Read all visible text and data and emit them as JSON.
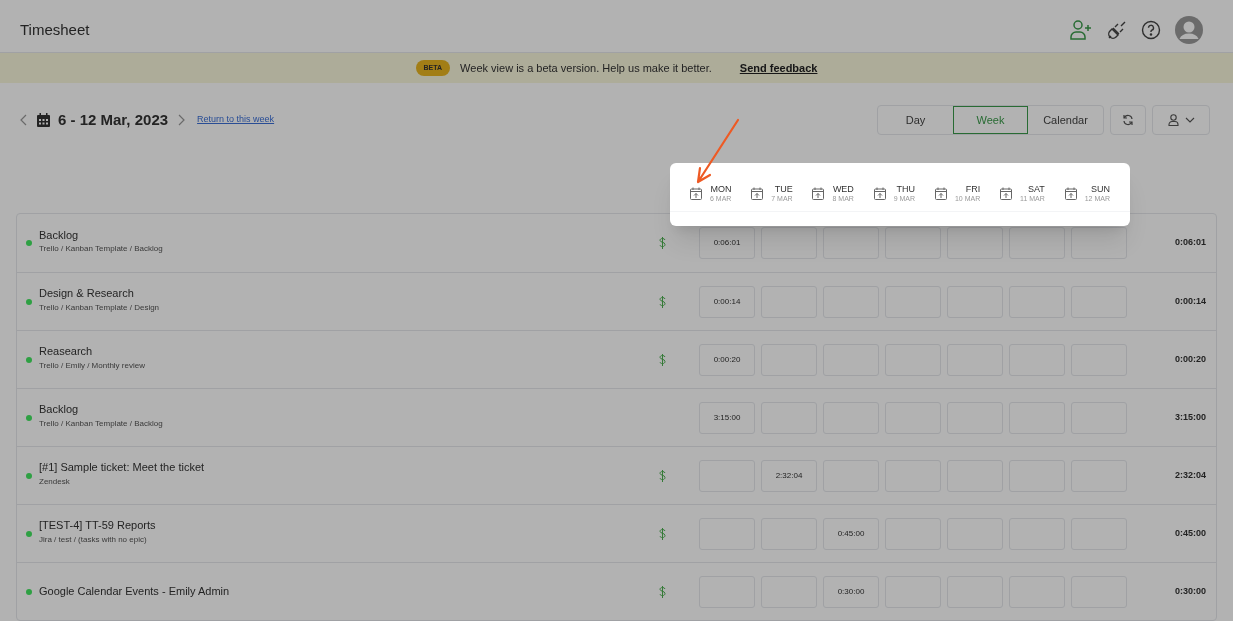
{
  "header": {
    "title": "Timesheet"
  },
  "banner": {
    "badge": "BETA",
    "message": "Week view is a beta version. Help us make it better.",
    "link": "Send feedback"
  },
  "toolbar": {
    "range": "6 - 12 Mar, 2023",
    "return_link": "Return to this week",
    "views": [
      {
        "label": "Day",
        "selected": false
      },
      {
        "label": "Week",
        "selected": true
      },
      {
        "label": "Calendar",
        "selected": false
      }
    ]
  },
  "day_picker": [
    {
      "day": "MON",
      "date": "6 MAR"
    },
    {
      "day": "TUE",
      "date": "7 MAR"
    },
    {
      "day": "WED",
      "date": "8 MAR"
    },
    {
      "day": "THU",
      "date": "9 MAR"
    },
    {
      "day": "FRI",
      "date": "10 MAR"
    },
    {
      "day": "SAT",
      "date": "11 MAR"
    },
    {
      "day": "SUN",
      "date": "12 MAR"
    }
  ],
  "rows": [
    {
      "title": "Backlog",
      "path": "Trello / Kanban Template / Backlog",
      "color": "#2ea043",
      "billable": true,
      "cells": [
        "0:06:01",
        null,
        null,
        null,
        null,
        null,
        null
      ],
      "total": "0:06:01"
    },
    {
      "title": "Design & Research",
      "path": "Trello / Kanban Template / Design",
      "color": "#2ea043",
      "billable": true,
      "cells": [
        "0:00:14",
        null,
        null,
        null,
        null,
        null,
        null
      ],
      "total": "0:00:14"
    },
    {
      "title": "Reasearch",
      "path": "Trello / Emily / Monthly review",
      "color": "#2ea043",
      "billable": true,
      "cells": [
        "0:00:20",
        null,
        null,
        null,
        null,
        null,
        null
      ],
      "total": "0:00:20"
    },
    {
      "title": "Backlog",
      "path": "Trello / Kanban Template / Backlog",
      "color": "#2ea043",
      "billable": false,
      "cells": [
        "3:15:00",
        null,
        null,
        null,
        null,
        null,
        null
      ],
      "total": "3:15:00"
    },
    {
      "title": "[#1] Sample ticket: Meet the ticket",
      "path": "Zendesk",
      "color": "#2ea043",
      "billable": true,
      "cells": [
        null,
        "2:32:04",
        null,
        null,
        null,
        null,
        null
      ],
      "total": "2:32:04"
    },
    {
      "title": "[TEST-4] TT-59 Reports",
      "path": "Jira / test / (tasks with no epic)",
      "color": "#2ea043",
      "billable": true,
      "cells": [
        null,
        null,
        "0:45:00",
        null,
        null,
        null,
        null
      ],
      "total": "0:45:00"
    },
    {
      "title": "Google Calendar Events - Emily Admin",
      "color": "#2ea043",
      "billable": true,
      "cells": [
        null,
        null,
        "0:30:00",
        null,
        null,
        null,
        null
      ],
      "total": "0:30:00"
    }
  ]
}
